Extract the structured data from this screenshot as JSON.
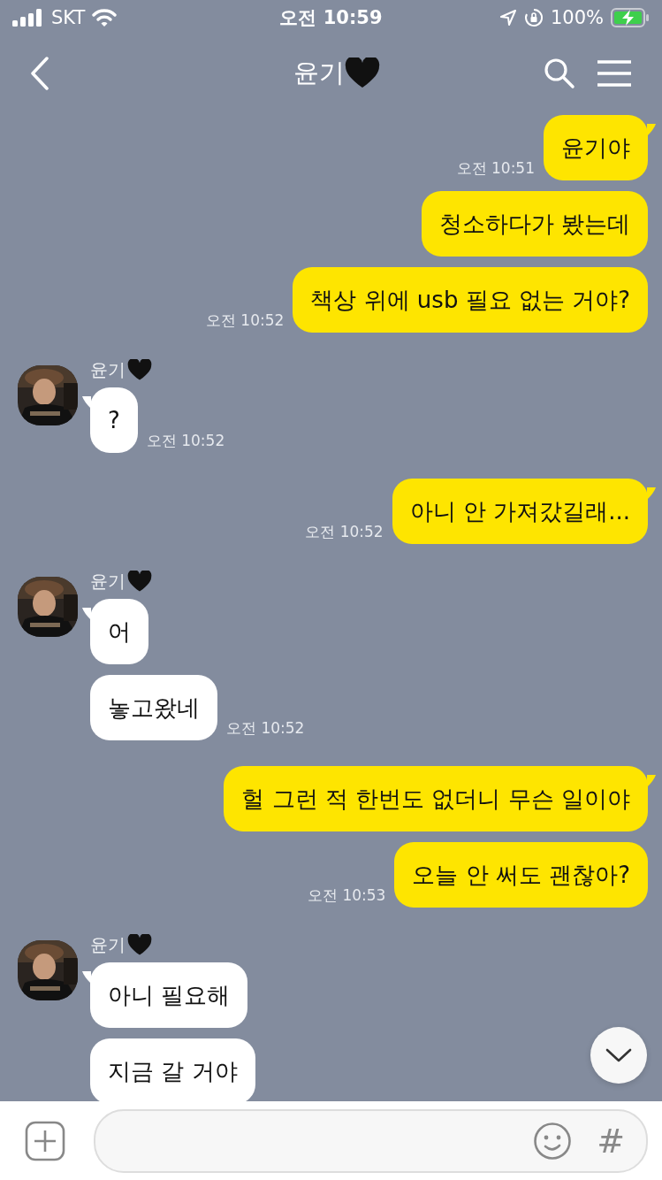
{
  "status_bar": {
    "carrier": "SKT",
    "time": "오전 10:59",
    "battery": "100%"
  },
  "header": {
    "title": "윤기"
  },
  "messages": [
    {
      "kind": "sent",
      "text": "윤기야",
      "time": "오전 10:51"
    },
    {
      "kind": "sent",
      "text": "청소하다가 봤는데"
    },
    {
      "kind": "sent",
      "text": "책상 위에 usb 필요 없는 거야?",
      "time": "오전 10:52"
    },
    {
      "kind": "received",
      "sender": "윤기",
      "text": "?",
      "time": "오전 10:52"
    },
    {
      "kind": "sent",
      "text": "아니 안 가져갔길래...",
      "time": "오전 10:52"
    },
    {
      "kind": "received",
      "sender": "윤기",
      "text": "어"
    },
    {
      "kind": "received",
      "text": "놓고왔네",
      "time": "오전 10:52"
    },
    {
      "kind": "sent",
      "text": "헐 그런 적 한번도 없더니 무슨 일이야"
    },
    {
      "kind": "sent",
      "text": "오늘 안 써도 괜찮아?",
      "time": "오전 10:53"
    },
    {
      "kind": "received",
      "sender": "윤기",
      "text": "아니 필요해"
    },
    {
      "kind": "received",
      "text": "지금 갈 거야"
    }
  ],
  "input_bar": {
    "hash": "#"
  }
}
